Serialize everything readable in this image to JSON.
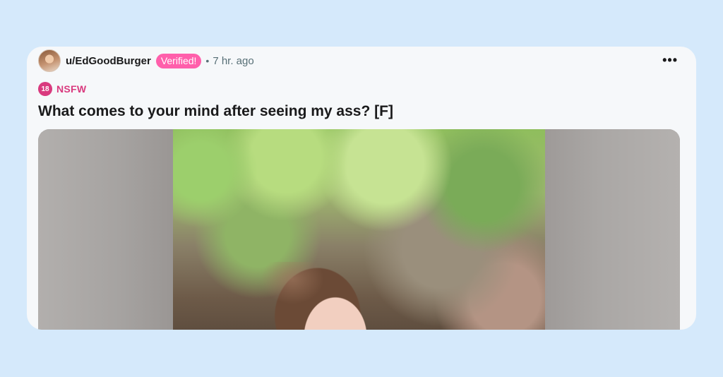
{
  "post": {
    "username": "u/EdGoodBurger",
    "verified_label": "Verified!",
    "separator": "•",
    "time": "7 hr. ago",
    "more_glyph": "•••",
    "nsfw_icon_text": "18",
    "nsfw_label": "NSFW",
    "title": "What comes to your mind after seeing my ass? [F]"
  },
  "colors": {
    "page_background": "#d5e9fb",
    "card_background": "#f6f8fa",
    "verified_badge": "#ff5fab",
    "nsfw_accent": "#d93a7e"
  },
  "icons": {
    "more": "more-options-icon",
    "nsfw": "nsfw-18-icon",
    "avatar": "user-avatar"
  }
}
